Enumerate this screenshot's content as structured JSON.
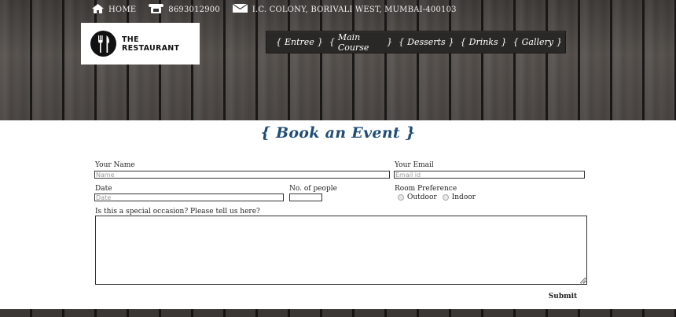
{
  "topbar": {
    "home_label": "HOME",
    "phone": "8693012900",
    "address": "I.C. COLONY, BORIVALI WEST, MUMBAI-400103"
  },
  "logo": {
    "line1": "THE",
    "line2": "RESTAURANT"
  },
  "nav": {
    "items": [
      {
        "label": "Entree"
      },
      {
        "label": "Main Course"
      },
      {
        "label": "Desserts"
      },
      {
        "label": "Drinks"
      },
      {
        "label": "Gallery"
      }
    ]
  },
  "heading": {
    "text": "{ Book an Event }"
  },
  "form": {
    "name_label": "Your Name",
    "name_placeholder": "Name",
    "email_label": "Your Email",
    "email_placeholder": "Email id",
    "date_label": "Date",
    "date_placeholder": "Date",
    "people_label": "No. of people",
    "pref_label": "Room Preference",
    "pref_options": [
      "Outdoor",
      "Indoor"
    ],
    "occasion_label": "Is this a special occasion? Please tell us here?",
    "submit_label": "Submit"
  },
  "colors": {
    "heading": "#1f4d77",
    "nav_bg": "#2a2826"
  }
}
